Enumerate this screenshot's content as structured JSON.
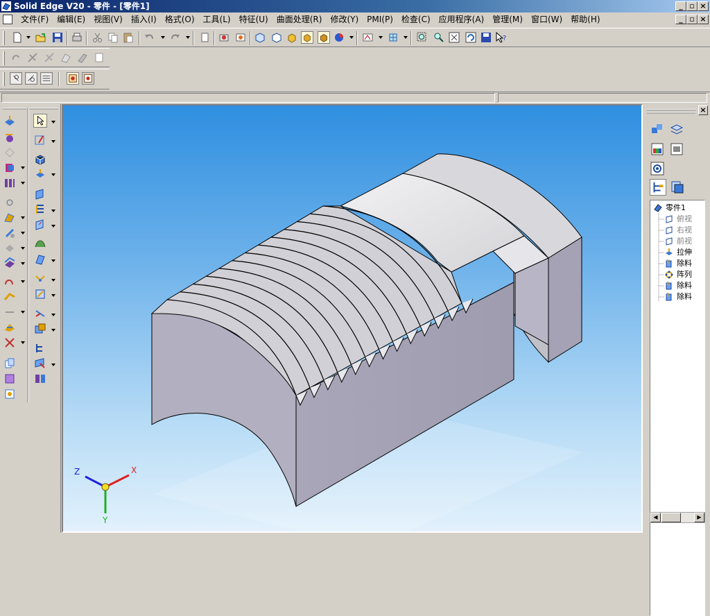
{
  "window": {
    "title": "Solid Edge V20 - 零件 - [零件1]"
  },
  "menu": {
    "items": [
      "文件(F)",
      "编辑(E)",
      "视图(V)",
      "插入(I)",
      "格式(O)",
      "工具(L)",
      "特征(U)",
      "曲面处理(R)",
      "修改(Y)",
      "PMI(P)",
      "检查(C)",
      "应用程序(A)",
      "管理(M)",
      "窗口(W)",
      "帮助(H)"
    ]
  },
  "toolbar_icons": {
    "row1": [
      "new-icon",
      "open-icon",
      "save-icon",
      "print-icon",
      "cut-icon",
      "copy-icon",
      "paste-icon",
      "undo-icon",
      "redo-icon",
      "select-doc-icon",
      "feature-lib-icon",
      "render-icon",
      "view-iso-icon",
      "view-front-icon",
      "view-shaded-icon",
      "view-wire-icon",
      "view-shaded-active-icon",
      "sphere-icon",
      "sketch-view-icon",
      "grid-icon",
      "zoom-area-icon",
      "zoom-icon",
      "fit-icon",
      "rotate-view-icon",
      "save-view-icon",
      "whats-this-icon"
    ],
    "row2": [
      "hist-icon-1",
      "hist-icon-2",
      "hist-icon-3",
      "hist-icon-4",
      "hist-icon-5",
      "hist-icon-6"
    ],
    "row3": [
      "pick-icon-1",
      "pick-icon-2",
      "pick-icon-3",
      "ribbon-icon-1",
      "ribbon-icon-2"
    ]
  },
  "feature_tree": {
    "root": "零件1",
    "items": [
      {
        "label": "俯视",
        "icon": "plane-icon",
        "dim": true
      },
      {
        "label": "右视",
        "icon": "plane-icon",
        "dim": true
      },
      {
        "label": "前视",
        "icon": "plane-icon",
        "dim": true
      },
      {
        "label": "拉伸",
        "icon": "extrude-icon",
        "dim": false
      },
      {
        "label": "除料",
        "icon": "cutout-icon",
        "dim": false
      },
      {
        "label": "阵列",
        "icon": "pattern-icon",
        "dim": false
      },
      {
        "label": "除料",
        "icon": "cutout-icon",
        "dim": false
      },
      {
        "label": "除料",
        "icon": "cutout-icon",
        "dim": false
      }
    ]
  },
  "triad": {
    "x_label": "X",
    "y_label": "Y",
    "z_label": "Z"
  },
  "colors": {
    "title_start": "#0a246a",
    "viewport_top": "#2f8fe0",
    "viewport_bottom": "#e2f1fc",
    "part_face_light": "#e8e8ea",
    "part_face_mid": "#c8c8cc",
    "part_face_dark": "#a4a2b4",
    "axis_x": "#e02020",
    "axis_y": "#20b020",
    "axis_z": "#2020e0"
  }
}
